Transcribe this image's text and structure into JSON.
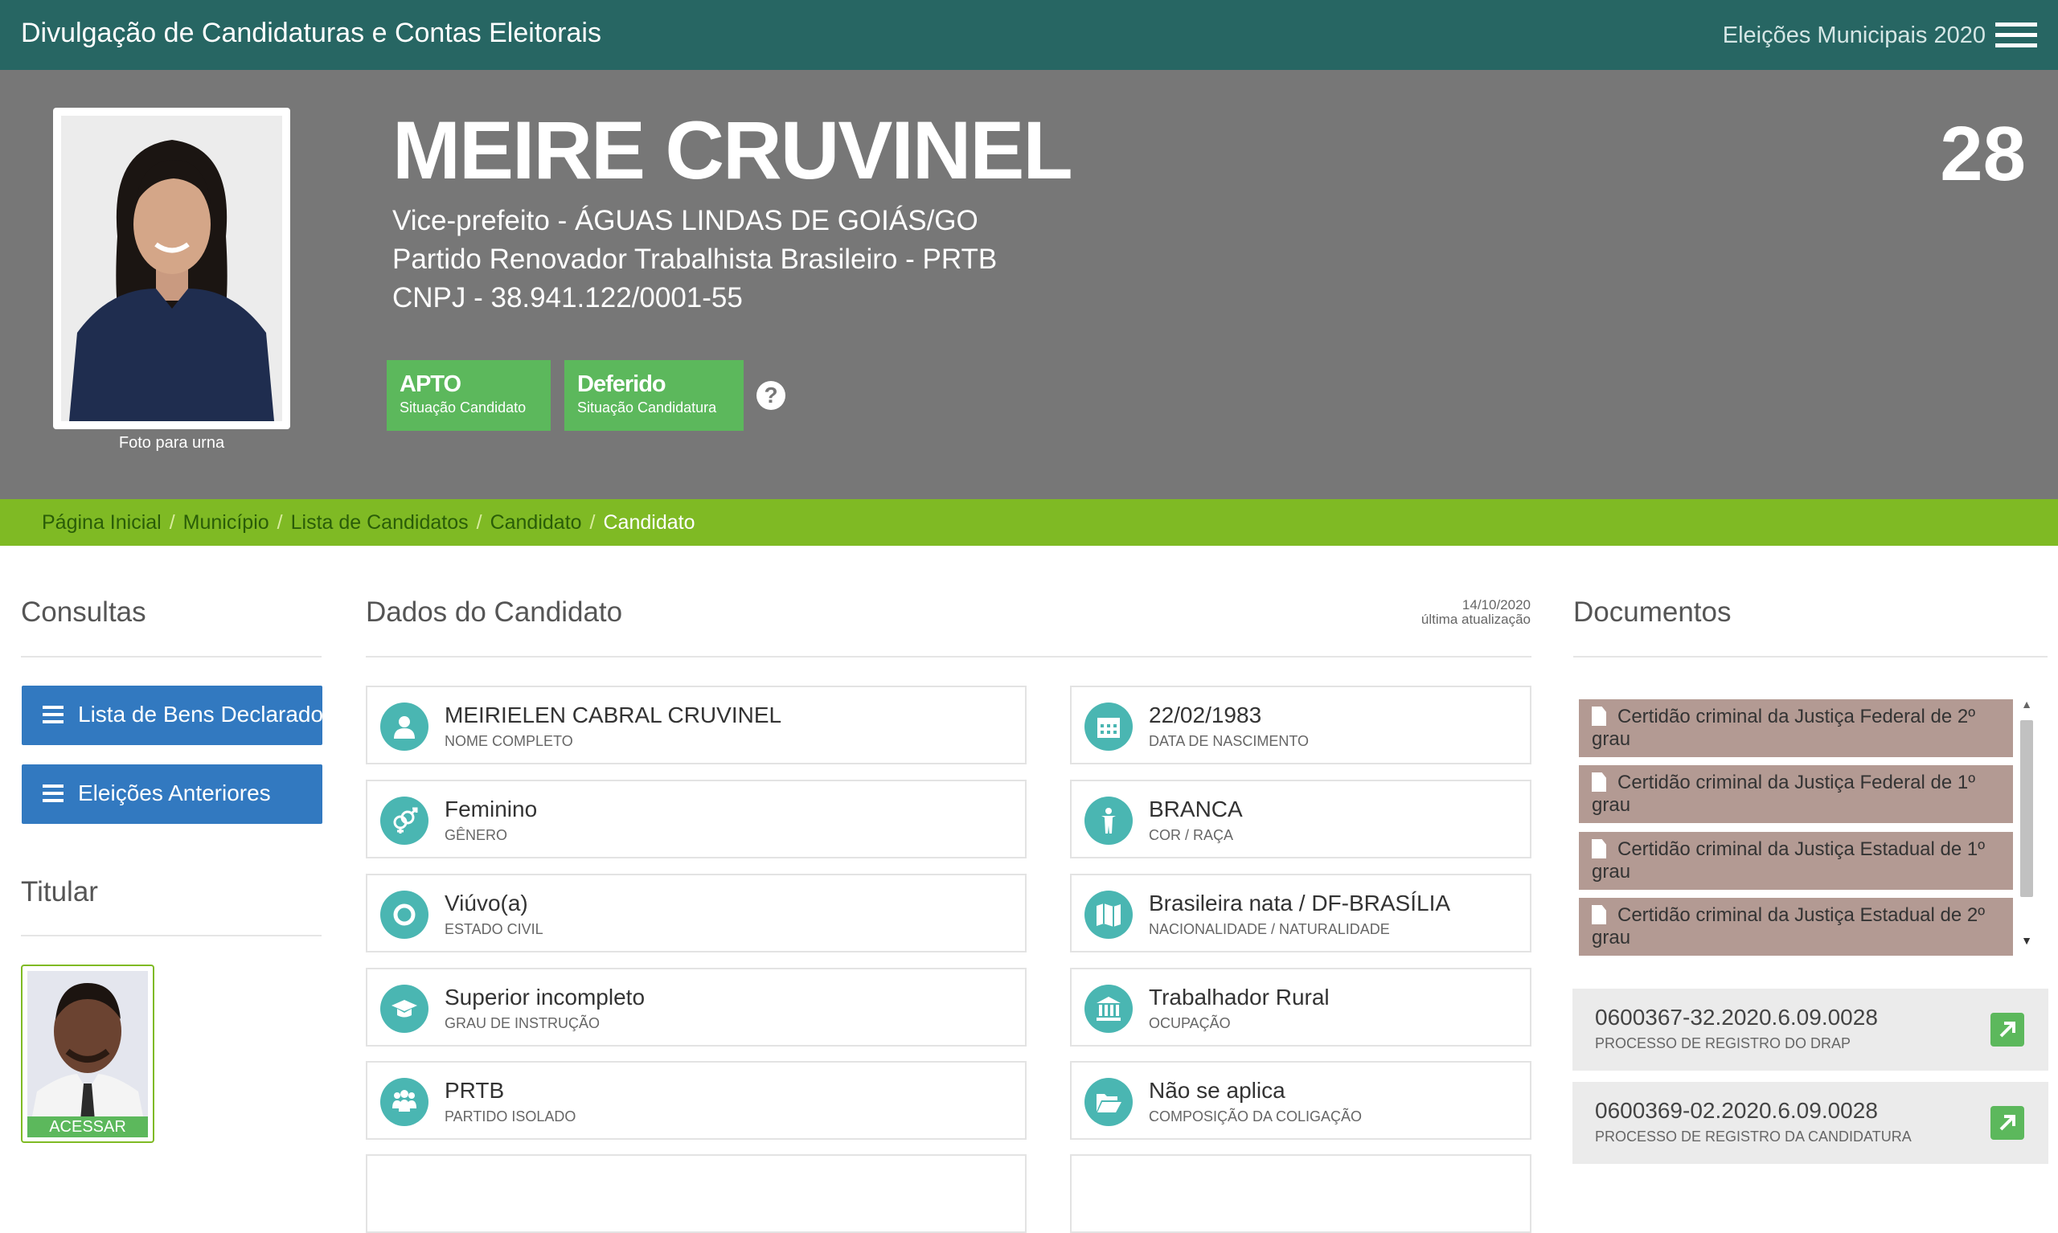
{
  "header": {
    "app_title": "Divulgação de Candidaturas e Contas Eleitorais",
    "election": "Eleições Municipais 2020"
  },
  "candidate": {
    "name": "MEIRE CRUVINEL",
    "office": "Vice-prefeito - ÁGUAS LINDAS DE GOIÁS/GO",
    "party": "Partido Renovador Trabalhista Brasileiro - PRTB",
    "cnpj": "CNPJ - 38.941.122/0001-55",
    "number": "28",
    "photo_caption": "Foto para urna",
    "badges": [
      {
        "value": "APTO",
        "label": "Situação Candidato"
      },
      {
        "value": "Deferido",
        "label": "Situação Candidatura"
      }
    ],
    "help": "?"
  },
  "breadcrumb": {
    "items": [
      "Página Inicial",
      "Município",
      "Lista de Candidatos",
      "Candidato"
    ],
    "active": "Candidato",
    "separator": "/"
  },
  "consultas": {
    "title": "Consultas",
    "buttons": [
      "Lista de Bens Declarados",
      "Eleições Anteriores"
    ]
  },
  "titular": {
    "title": "Titular",
    "access_label": "ACESSAR"
  },
  "dados": {
    "title": "Dados do Candidato",
    "update_date": "14/10/2020",
    "update_label": "última atualização",
    "fields": [
      {
        "value": "MEIRIELEN CABRAL CRUVINEL",
        "label": "NOME COMPLETO",
        "icon": "person-icon"
      },
      {
        "value": "22/02/1983",
        "label": "DATA DE NASCIMENTO",
        "icon": "calendar-icon"
      },
      {
        "value": "Feminino",
        "label": "GÊNERO",
        "icon": "gender-icon"
      },
      {
        "value": "BRANCA",
        "label": "COR / RAÇA",
        "icon": "person-standing-icon"
      },
      {
        "value": "Viúvo(a)",
        "label": "ESTADO CIVIL",
        "icon": "ring-icon"
      },
      {
        "value": "Brasileira nata / DF-BRASÍLIA",
        "label": "NACIONALIDADE / NATURALIDADE",
        "icon": "map-icon"
      },
      {
        "value": "Superior incompleto",
        "label": "GRAU DE INSTRUÇÃO",
        "icon": "graduation-cap-icon"
      },
      {
        "value": "Trabalhador Rural",
        "label": "OCUPAÇÃO",
        "icon": "institution-icon"
      },
      {
        "value": "PRTB",
        "label": "PARTIDO ISOLADO",
        "icon": "group-icon"
      },
      {
        "value": "Não se aplica",
        "label": "COMPOSIÇÃO DA COLIGAÇÃO",
        "icon": "folder-open-icon"
      }
    ]
  },
  "documentos": {
    "title": "Documentos",
    "items": [
      {
        "line1": "Certidão criminal da Justiça Federal de 2º",
        "line2": "grau"
      },
      {
        "line1": "Certidão criminal da Justiça Federal de 1º",
        "line2": "grau"
      },
      {
        "line1": "Certidão criminal da Justiça Estadual de 1º",
        "line2": "grau"
      },
      {
        "line1": "Certidão criminal da Justiça Estadual de 2º",
        "line2": "grau"
      }
    ],
    "processes": [
      {
        "number": "0600367-32.2020.6.09.0028",
        "label": "PROCESSO DE REGISTRO DO DRAP"
      },
      {
        "number": "0600369-02.2020.6.09.0028",
        "label": "PROCESSO DE REGISTRO DA CANDIDATURA"
      }
    ]
  },
  "colors": {
    "topbar": "#276663",
    "hero": "#777777",
    "breadcrumb": "#7fba24",
    "badge": "#5cb85c",
    "button": "#3279c0",
    "icon_circle": "#4ab6b2",
    "document": "#b39a93"
  }
}
